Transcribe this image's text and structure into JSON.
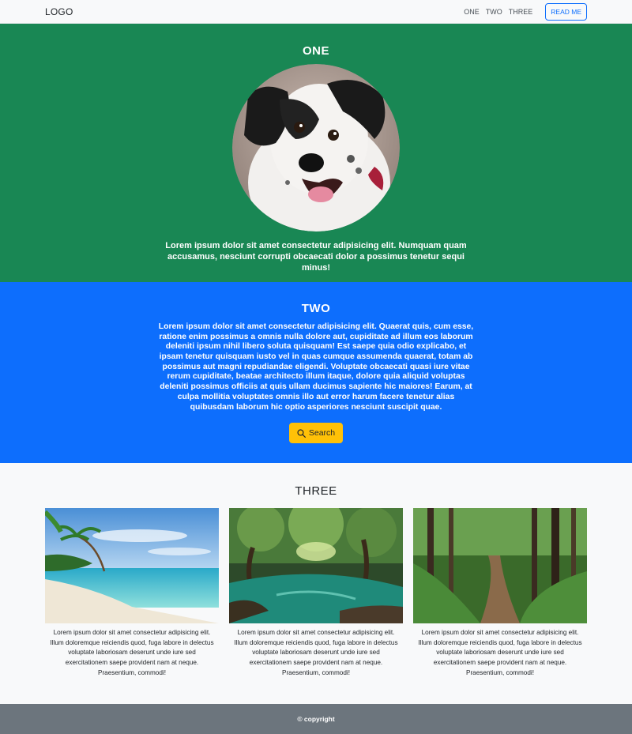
{
  "navbar": {
    "logo": "LOGO",
    "links": [
      "ONE",
      "TWO",
      "THREE"
    ],
    "button_label": "READ ME"
  },
  "section_one": {
    "title": "ONE",
    "text": "Lorem ipsum dolor sit amet consectetur adipisicing elit. Numquam quam accusamus, nesciunt corrupti obcaecati dolor a possimus tenetur sequi minus!"
  },
  "section_two": {
    "title": "TWO",
    "text": "Lorem ipsum dolor sit amet consectetur adipisicing elit. Quaerat quis, cum esse, ratione enim possimus a omnis nulla dolore aut, cupiditate ad illum eos laborum deleniti ipsum nihil libero soluta quisquam! Est saepe quia odio explicabo, et ipsam tenetur quisquam iusto vel in quas cumque assumenda quaerat, totam ab possimus aut magni repudiandae eligendi. Voluptate obcaecati quasi iure vitae rerum cupiditate, beatae architecto illum itaque, dolore quia aliquid voluptas deleniti possimus officiis at quis ullam ducimus sapiente hic maiores! Earum, at culpa mollitia voluptates omnis illo aut error harum facere tenetur alias quibusdam laborum hic optio asperiores nesciunt suscipit quae.",
    "button_label": "Search"
  },
  "section_three": {
    "title": "THREE",
    "cards": [
      {
        "text": "Lorem ipsum dolor sit amet consectetur adipisicing elit. Illum doloremque reiciendis quod, fuga labore in delectus voluptate laboriosam deserunt unde iure sed exercitationem saepe provident nam at neque. Praesentium, commodi!"
      },
      {
        "text": "Lorem ipsum dolor sit amet consectetur adipisicing elit. Illum doloremque reiciendis quod, fuga labore in delectus voluptate laboriosam deserunt unde iure sed exercitationem saepe provident nam at neque. Praesentium, commodi!"
      },
      {
        "text": "Lorem ipsum dolor sit amet consectetur adipisicing elit. Illum doloremque reiciendis quod, fuga labore in delectus voluptate laboriosam deserunt unde iure sed exercitationem saepe provident nam at neque. Praesentium, commodi!"
      }
    ]
  },
  "footer": {
    "text": "© copyright"
  },
  "colors": {
    "green": "#198754",
    "blue": "#0d6efd",
    "yellow": "#ffc107",
    "footer_gray": "#6c757d",
    "light": "#f8f9fa"
  },
  "icons": {
    "search_button": "search-icon"
  }
}
